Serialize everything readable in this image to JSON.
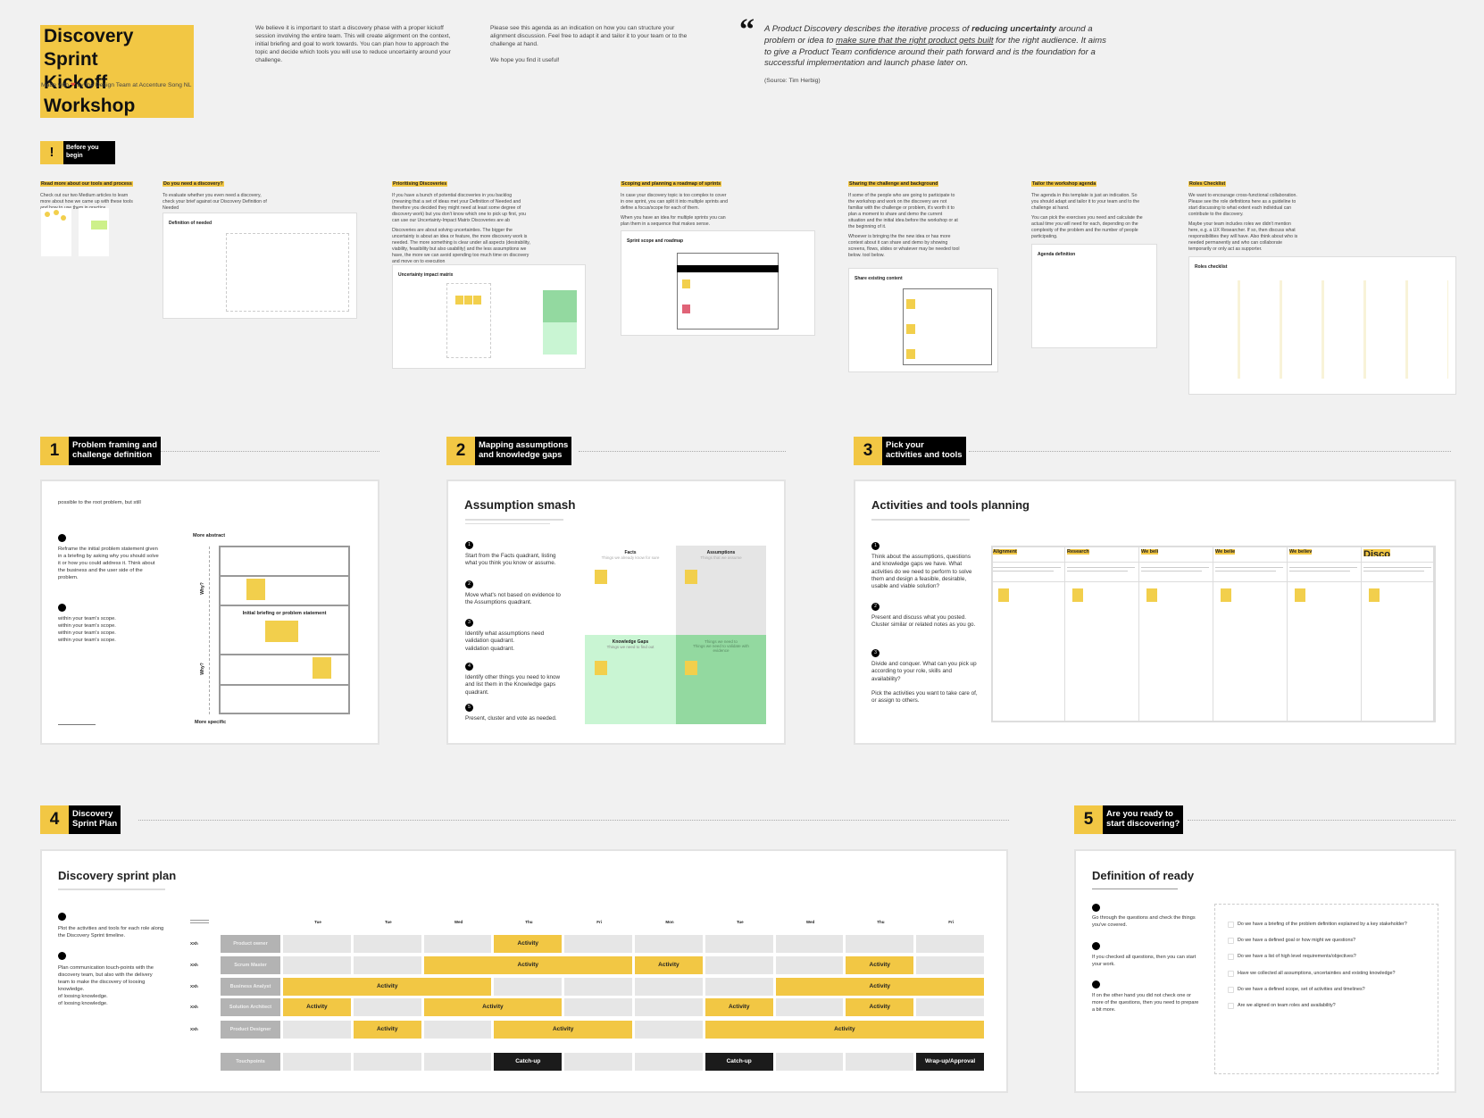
{
  "header": {
    "title_line1": "Discovery Sprint",
    "title_line2": "Kickoff Workshop",
    "made_with_prefix": "Made with",
    "made_with_suffix": "by the Design Team at Accenture Song NL",
    "intro": "We believe it is important to start a discovery phase with a proper kickoff session involving the entire team. This will create alignment on the context, initial briefing and goal to work towards. You can plan how to approach the topic and decide which tools you will use to reduce uncertainty around your challenge.",
    "agenda_note": "Please see this agenda as an indication on how you can structure your alignment discussion. Feel free to adapt it and tailor it to your team or to the challenge at hand.",
    "hope": "We hope you find it useful!",
    "quote_a": "A Product Discovery describes the iterative process of ",
    "quote_b": "reducing uncertainty",
    "quote_c": " around a problem or idea to ",
    "quote_d": "make sure that the right product gets built",
    "quote_e": " for the right audience. It aims to give a Product Team confidence around their path forward and is the foundation for a successful implementation and launch phase later on.",
    "source": "(Source: Tim Herbig)"
  },
  "before": {
    "badge": "!",
    "label": "Before you\nbegin",
    "columns": [
      {
        "title": "Read more about our tools and process",
        "text": "Check out our two Medium articles to learn more about how we came up with these tools and how to use them in practice."
      },
      {
        "title": "Do you need a discovery?",
        "text": "To evaluate whether you even need a discovery, check your brief against our Discovery Definition of Needed",
        "thumb": "Definition of needed"
      },
      {
        "title": "Prioritising Discoveries",
        "text": "If you have a bunch of potential discoveries in you backlog (meaning that a set of ideas met your Definition of Needed and therefore you decided they might need at least some degree of discovery work) but you don't know which one to pick up first, you can use our Uncertainty-Impact Matrix Discoveries are ab",
        "text2": "Discoveries are about solving uncertainties. The bigger the uncertainty is about an idea or feature, the more discovery work is needed. The more something is clear under all aspects (desirability, viability, feasibility but also usability) and the less assumptions we have, the more we can avoid spending too much time on discovery and move on to execution",
        "thumb": "Uncertainty impact matrix"
      },
      {
        "title": "Scoping and planning a roadmap of sprints",
        "text": "In case your discovery topic is too complex to cover in one sprint, you can split it into multiple sprints and define a focus/scope for each of them.",
        "text2": "When you have an idea for multiple sprints you can plan them in a sequence that makes sense.",
        "thumb": "Sprint scope and roadmap"
      },
      {
        "title": "Sharing the challenge and background",
        "text": "If some of the people who are going to participate to the workshop and work on the discovery are not familiar with the challenge or problem, it's worth it to plan a moment to share and demo the current situation and the initial idea before the workshop or at the beginning of it.",
        "text2": "Whoever is bringing the the new idea or has more context about it can share and demo by showing screens, flows, slides or whatever may be needed tool below. tool below.",
        "thumb": "Share existing content"
      },
      {
        "title": "Tailor the workshop agenda",
        "text": "The agenda in this template is just an indication. So you should adapt and tailor it to your team and to the challenge at hand.",
        "text2": "You can pick the exercises you need and calculate the actual time you will need for each, depending on the complexity of the problem and the number of people participating.",
        "thumb": "Agenda definition"
      },
      {
        "title": "Roles Checklist",
        "text": "We want to encourage cross-functional collaboration. Please see the role definitions here as a guideline to start discussing to what extent each individual can contribute to the discovery.",
        "text2": "Maybe your team includes roles we didn't mention here, e.g. a UX Researcher. If so, then discuss what responsibilities they will have. Also think about who is needed permanently and who can collaborate temporarily or only act as supporter.",
        "thumb": "Roles checklist"
      }
    ]
  },
  "s1": {
    "num": "1",
    "label": "Problem framing and\nchallenge definition",
    "intro": "possible to the root problem, but still",
    "step1": "Reframe the initial problem statement given in a briefing by asking why you should solve it or how you could address it. Think about the business and the user side of the problem.",
    "step2": "within your team's scope.\nwithin your team's scope.\nwithin your team's scope.\nwithin your team's scope.",
    "more_abstract": "More abstract",
    "more_specific": "More specific",
    "why": "Why?",
    "initial": "Initial briefing or problem statement"
  },
  "s2": {
    "num": "2",
    "label": "Mapping assumptions\nand knowledge gaps",
    "title": "Assumption smash",
    "steps": [
      "Start from the Facts quadrant, listing what you think you know or assume.",
      "Move what's not based on evidence to the Assumptions quadrant.",
      "Identify what assumptions need validation quadrant.\nvalidation quadrant.",
      "Identify other things you need to know and list them in the Knowledge gaps quadrant.",
      "Present, cluster and vote as needed."
    ],
    "q_facts": "Facts",
    "q_facts_sub": "Things we already know for sure",
    "q_assump": "Assumptions",
    "q_assump_sub": "Things that we assume",
    "q_gaps": "Knowledge Gaps",
    "q_gaps_sub": "Things we need to find out",
    "q_br": "Things we need to\nThings we need to validate with evidence"
  },
  "s3": {
    "num": "3",
    "label": "Pick your\nactivities and tools",
    "title": "Activities and tools planning",
    "steps": [
      "Think about the assumptions, questions and knowledge gaps we have. What activities do we need to perform to solve them and design a feasible, desirable, usable and viable solution?",
      "Present and discuss what you posted. Cluster similar or related notes as you go.",
      "Divide and conquer. What can you pick up according to your role, skills and availability?\n\nPick the activities you want to take care of, or assign to others."
    ],
    "columns": [
      "Alignment",
      "Research",
      "We beli",
      "We belie",
      "We believ",
      "Disco"
    ]
  },
  "s4": {
    "num": "4",
    "label": "Discovery\nSprint Plan",
    "title": "Discovery sprint plan",
    "step1": "Plot the activities and tools for each role along the Discovery Sprint timeline.",
    "step2": "Plan communication touch-points with the discovery team, but also with the delivery team to make the discovery of loosing knowledge.\nof loosing knowledge.\nof loosing knowledge.",
    "days": [
      "Tue",
      "Tue",
      "Wed",
      "Thu",
      "Fri",
      "Mon",
      "Tue",
      "Wed",
      "Thu",
      "Fri"
    ],
    "hours": "XXh",
    "roles": [
      {
        "name": "Product owner",
        "blocks": [
          {
            "start": 4,
            "span": 1,
            "label": "Activity"
          }
        ]
      },
      {
        "name": "Scrum Master",
        "blocks": [
          {
            "start": 3,
            "span": 3,
            "label": "Activity"
          },
          {
            "start": 6,
            "span": 1,
            "label": "Activity"
          },
          {
            "start": 9,
            "span": 1,
            "label": "Activity"
          }
        ]
      },
      {
        "name": "Business Analyst",
        "blocks": [
          {
            "start": 1,
            "span": 3,
            "label": "Activity"
          },
          {
            "start": 8,
            "span": 3,
            "label": "Activity"
          }
        ]
      },
      {
        "name": "Solution Architect",
        "blocks": [
          {
            "start": 1,
            "span": 1,
            "label": "Activity"
          },
          {
            "start": 3,
            "span": 2,
            "label": "Activity"
          },
          {
            "start": 7,
            "span": 1,
            "label": "Activity"
          },
          {
            "start": 9,
            "span": 1,
            "label": "Activity"
          }
        ]
      },
      {
        "name": "Product Designer",
        "blocks": [
          {
            "start": 2,
            "span": 1,
            "label": "Activity"
          },
          {
            "start": 4,
            "span": 2,
            "label": "Activity"
          },
          {
            "start": 7,
            "span": 4,
            "label": "Activity"
          }
        ]
      }
    ],
    "touchpoints": {
      "name": "Touchpoints",
      "blocks": [
        {
          "start": 4,
          "span": 1,
          "label": "Catch-up"
        },
        {
          "start": 7,
          "span": 1,
          "label": "Catch-up"
        },
        {
          "start": 10,
          "span": 1,
          "label": "Wrap-up/Approval"
        }
      ]
    }
  },
  "s5": {
    "num": "5",
    "label": "Are you ready to\nstart discovering?",
    "title": "Definition of ready",
    "step1": "Go through the questions and check the things you've covered.",
    "step2": "If you checked all questions, then you can start your work.",
    "step3": "If on the other hand you did not check one or more of the questions, then you need to prepare a bit more.",
    "checklist": [
      "Do we have a briefing of the problem definition explained by a key stakeholder?",
      "Do we have a defined goal or how might we questions?",
      "Do we have a list of high level requirements/objectives?",
      "Have we collected all assumptions, uncertainties and existing knowledge?",
      "Do we have a defined scope, set of activities and timelines?",
      "Are we aligned on team roles and availability?"
    ]
  },
  "colors": {
    "accent": "#f2c744",
    "background": "#f1f1f1",
    "facts": "#ffffff",
    "assumptions": "#e5e5e5",
    "knowledge_gaps": "#c9f5d3",
    "validate": "#93d9a0"
  }
}
